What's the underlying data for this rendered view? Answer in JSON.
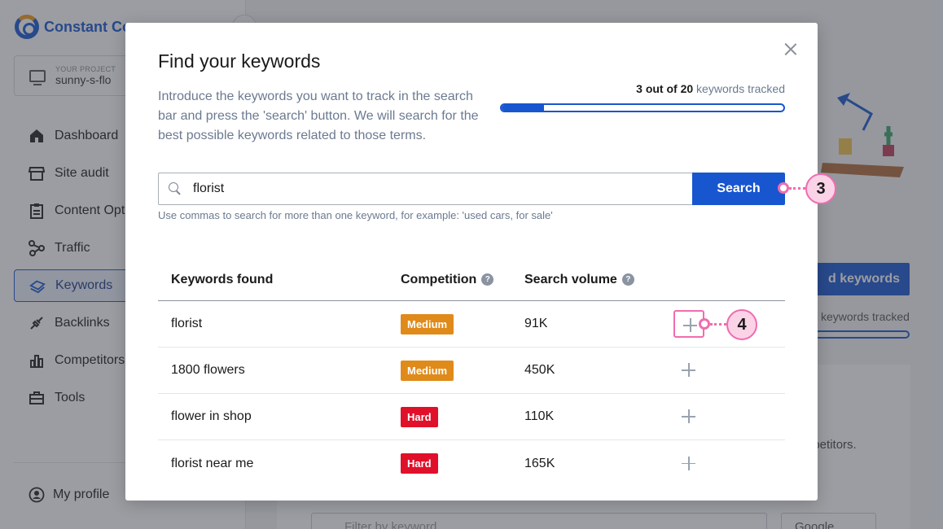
{
  "sidebar": {
    "brand": "Constant Co",
    "project_label": "YOUR PROJECT",
    "project_name": "sunny-s-flo",
    "items": [
      {
        "label": "Dashboard",
        "icon": "home-icon"
      },
      {
        "label": "Site audit",
        "icon": "store-icon"
      },
      {
        "label": "Content Opti",
        "icon": "clipboard-icon"
      },
      {
        "label": "Traffic",
        "icon": "traffic-icon"
      },
      {
        "label": "Keywords",
        "icon": "keywords-icon",
        "active": true
      },
      {
        "label": "Backlinks",
        "icon": "plug-icon"
      },
      {
        "label": "Competitors",
        "icon": "chart-icon"
      },
      {
        "label": "Tools",
        "icon": "toolbox-icon"
      }
    ],
    "profile": "My profile"
  },
  "background": {
    "add_keywords_button": "d keywords",
    "tracked_text": "keywords tracked",
    "competitors_text": "npetitors.",
    "filter_placeholder": "Filter by keyword",
    "engine_select": "Google"
  },
  "modal": {
    "title": "Find your keywords",
    "intro": "Introduce the keywords you want to track in the search bar and press the 'search' button. We will search for the best possible keywords related to those terms.",
    "tracked": {
      "count": "3 out of 20",
      "suffix": " keywords tracked",
      "used": 3,
      "total": 20
    },
    "search": {
      "value": "florist",
      "button": "Search",
      "hint": "Use commas to search for more than one keyword, for example: 'used cars, for sale'"
    },
    "table": {
      "headers": {
        "keyword": "Keywords found",
        "competition": "Competition",
        "volume": "Search volume"
      },
      "rows": [
        {
          "keyword": "florist",
          "competition": "Medium",
          "level": "medium",
          "volume": "91K"
        },
        {
          "keyword": "1800 flowers",
          "competition": "Medium",
          "level": "medium",
          "volume": "450K"
        },
        {
          "keyword": "flower in shop",
          "competition": "Hard",
          "level": "hard",
          "volume": "110K"
        },
        {
          "keyword": "florist near me",
          "competition": "Hard",
          "level": "hard",
          "volume": "165K"
        }
      ]
    }
  },
  "callouts": {
    "search": "3",
    "add": "4"
  },
  "colors": {
    "accent": "#1856d0",
    "medium": "#e08a1a",
    "hard": "#e0102a",
    "callout": "#f06cb0"
  }
}
